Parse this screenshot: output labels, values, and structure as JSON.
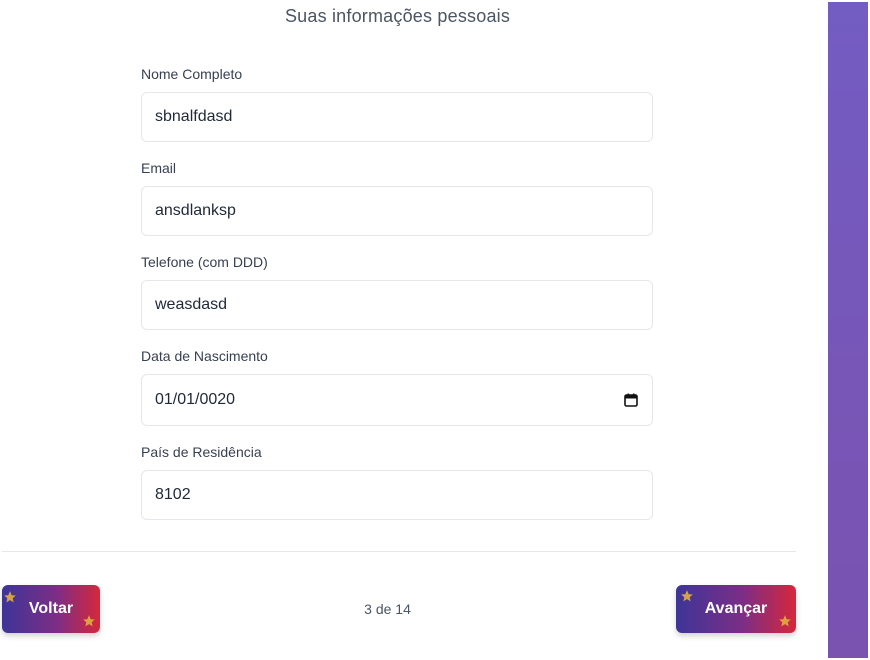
{
  "form": {
    "title": "Suas informações pessoais",
    "fields": [
      {
        "label": "Nome Completo",
        "value": "sbnalfdasd"
      },
      {
        "label": "Email",
        "value": "ansdlanksp"
      },
      {
        "label": "Telefone (com DDD)",
        "value": "weasdasd"
      },
      {
        "label": "Data de Nascimento",
        "value": "01/01/0020"
      },
      {
        "label": "País de Residência",
        "value": "8102"
      }
    ]
  },
  "navigation": {
    "back_label": "Voltar",
    "next_label": "Avançar",
    "page_counter": "3 de 14"
  },
  "icons": {
    "calendar": "calendar-icon",
    "star": "star-icon"
  },
  "colors": {
    "accent_purple": "#735cc2",
    "button_gradient_start": "#3d3597",
    "button_gradient_end": "#d6273b",
    "star": "#d4a24a"
  }
}
